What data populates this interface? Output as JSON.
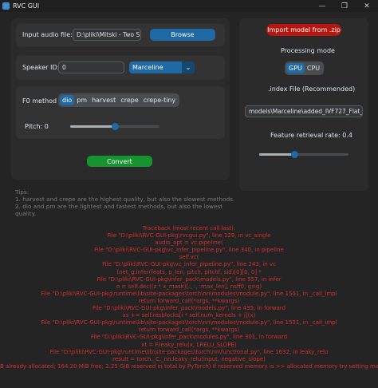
{
  "window": {
    "title": "RVC GUI",
    "controls": [
      "—",
      "❐",
      "✕"
    ]
  },
  "input_audio": {
    "label": "Input audio file:",
    "value": "D:\\pliki\\Mitski - Two S",
    "browse_label": "Browse"
  },
  "speaker": {
    "label": "Speaker ID:",
    "value": "0",
    "model_selected": "Marceline"
  },
  "f0": {
    "label": "F0 method",
    "methods": [
      "dio",
      "pm",
      "harvest",
      "crepe",
      "crepe-tiny"
    ],
    "selected": "dio",
    "pitch_label": "Pitch: 0",
    "pitch_position": 0.5
  },
  "convert_label": "Convert",
  "right": {
    "import_label": "Import model from .zip",
    "processing_mode_label": "Processing mode",
    "modes": [
      "GPU",
      "CPU"
    ],
    "mode_selected": "GPU",
    "index_label": ".index File (Recommended)",
    "index_value": "models\\Marceline\\added_IVF727_Flat_np",
    "feature_label": "Feature retrieval rate: 0.4",
    "feature_value": 0.4
  },
  "tips": {
    "title": "Tips:",
    "line1": "1. harvest and crepe are the highest quality, but also the slowest methods.",
    "line2": "2. dio and pm are the lightest and fastest methods, but also the lowest quality."
  },
  "traceback": [
    "Traceback (most recent call last):",
    "File \"D:\\pliki\\RVC-GUI-pkg\\rvcgui.py\", line 129, in vc_single",
    "audio_opt = vc.pipeline(",
    "File \"D:\\pliki\\RVC-GUI-pkg\\vc_infer_pipeline.py\", line 340, in pipeline",
    "self.vc(",
    "File \"D:\\pliki\\RVC-GUI-pkg\\vc_infer_pipeline.py\", line 243, in vc",
    "(net_g.infer(feats, p_len, pitch, pitchf, sid)[0][0, 0] *",
    "File \"D:\\pliki\\RVC-GUI-pkg\\infer_pack\\models.py\", line 557, in infer",
    "o = self.dec((z * x_mask)[:, :, :max_len], nsff0, g=g)",
    "File \"D:\\pliki\\RVC-GUI-pkg\\runtime\\lib\\site-packages\\torch\\nn\\modules\\module.py\", line 1501, in _call_impl",
    "return forward_call(*args, **kwargs)",
    "File \"D:\\pliki\\RVC-GUI-pkg\\infer_pack\\models.py\", line 435, in forward",
    "xs += self.resblocks[i * self.num_kernels + j](x)",
    "File \"D:\\pliki\\RVC-GUI-pkg\\runtime\\lib\\site-packages\\torch\\nn\\modules\\module.py\", line 1501, in _call_impl",
    "return forward_call(*args, **kwargs)",
    "File \"D:\\pliki\\RVC-GUI-pkg\\infer_pack\\modules.py\", line 301, in forward",
    "xt = F.leaky_relu(x, LRELU_SLOPE)",
    "File \"D:\\pliki\\RVC-GUI-pkg\\runtime\\lib\\site-packages\\torch\\nn\\functional.py\", line 1632, in leaky_relu",
    "result = torch._C._nn.leaky_relu(input, negative_slope)",
    "B already allocated; 164.20 MiB free; 2.25 GiB reserved in total by PyTorch) If reserved memory is >> allocated memory try setting max_"
  ]
}
